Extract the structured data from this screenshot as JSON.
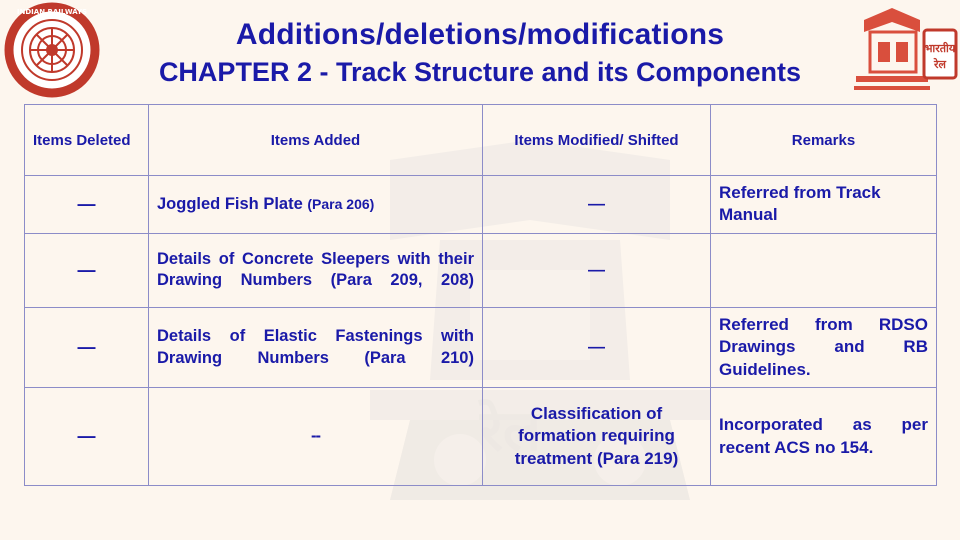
{
  "slide": {
    "title": "Additions/deletions/modifications",
    "subtitle": "CHAPTER 2 - Track Structure and its Components",
    "title_color": "#1a1aa8",
    "background_color": "#fdf6ee"
  },
  "emblem": {
    "name": "indian-railways-emblem",
    "top_text": "INDIAN RAILWAYS",
    "bottom_text": "भारतीय रेल"
  },
  "logo": {
    "name": "railway-building-logo"
  },
  "table": {
    "headers": [
      "Items Deleted",
      "Items Added",
      "Items Modified/ Shifted",
      "Remarks"
    ],
    "rows": [
      {
        "deleted": "—",
        "added": "Joggled Fish Plate",
        "added_para": "(Para 206)",
        "modified": "—",
        "remarks": "Referred from Track Manual"
      },
      {
        "deleted": "—",
        "added": "Details of Concrete Sleepers with their Drawing Numbers",
        "added_para": "(Para 209, 208)",
        "modified": "—",
        "remarks": ""
      },
      {
        "deleted": "—",
        "added": "Details of Elastic Fastenings with Drawing Numbers",
        "added_para": "(Para 210)",
        "modified": "—",
        "remarks": "Referred from RDSO Drawings and RB Guidelines."
      },
      {
        "deleted": "—",
        "added": "--",
        "added_para": "",
        "modified": "Classification of formation requiring treatment",
        "modified_para": "(Para 219)",
        "remarks": "Incorporated as per recent ACS no 154."
      }
    ]
  }
}
